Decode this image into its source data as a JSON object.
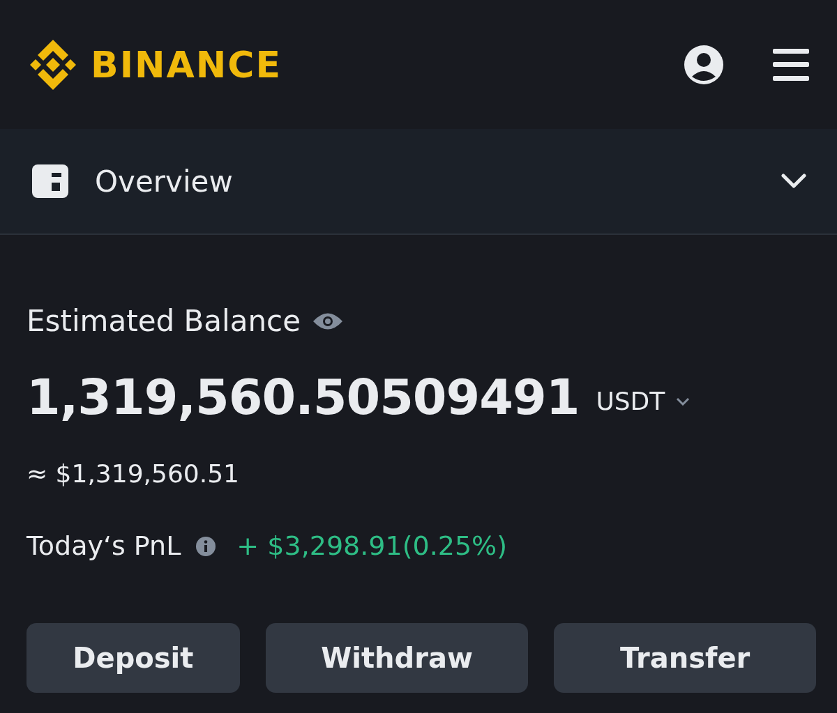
{
  "header": {
    "logo": "BINANCE"
  },
  "section": {
    "title": "Overview"
  },
  "balance": {
    "label": "Estimated Balance",
    "amount": "1,319,560.50509491",
    "currency": "USDT",
    "approx": "≈ $1,319,560.51"
  },
  "pnl": {
    "label": "Today‘s PnL",
    "value": "+ $3,298.91(0.25%)"
  },
  "buttons": [
    "Deposit",
    "Withdraw",
    "Transfer"
  ]
}
